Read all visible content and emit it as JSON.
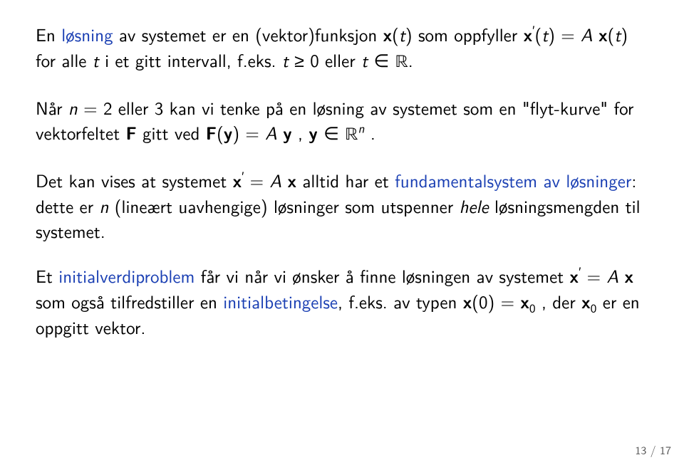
{
  "para1": {
    "t1": "En ",
    "t2": "løsning",
    "t3": " av systemet er en (vektor)funksjon ",
    "t4": "x",
    "t5": "(",
    "t6": "t",
    "t7": ") som oppfyller ",
    "t8": "x",
    "t9": "′",
    "t10": "(",
    "t11": "t",
    "t12": ") = ",
    "t13": "A",
    "t14": " ",
    "t15": "x",
    "t16": "(",
    "t17": "t",
    "t18": ") for alle ",
    "t19": "t",
    "t20": " i et gitt intervall, f.eks. ",
    "t21": "t",
    "t22": " ≥ 0 eller ",
    "t23": "t",
    "t24": " ∈ ",
    "t25": "ℝ",
    "t26": "."
  },
  "para2": {
    "t1": "Når ",
    "t2": "n",
    "t3": " = 2 eller 3 kan vi tenke på en løsning av systemet som en \"flyt-kurve\" for vektorfeltet ",
    "t4": "F",
    "t5": " gitt ved ",
    "t6": "F",
    "t7": "(",
    "t8": "y",
    "t9": ") = ",
    "t10": "A",
    "t11": " ",
    "t12": "y",
    "t13": " , ",
    "t14": "y",
    "t15": " ∈ ",
    "t16": "ℝ",
    "t17": "n",
    "t18": " ."
  },
  "para3": {
    "t1": "Det kan vises at systemet ",
    "t2": "x",
    "t3": "′",
    "t4": " = ",
    "t5": "A",
    "t6": " ",
    "t7": "x",
    "t8": " alltid har et ",
    "t9": "fundamentalsystem av løsninger",
    "t10": ": dette er ",
    "t11": "n",
    "t12": " (lineært uavhengige) løsninger som utspenner ",
    "t13": "hele",
    "t14": " løsningsmengden til systemet."
  },
  "para4": {
    "t1": "Et ",
    "t2": "initialverdiproblem",
    "t3": " får vi når vi ønsker å finne løsningen av systemet ",
    "t4": "x",
    "t5": "′",
    "t6": " = ",
    "t7": "A",
    "t8": " ",
    "t9": "x",
    "t10": " som også tilfredstiller en ",
    "t11": "initialbetingelse",
    "t12": ", f.eks. av typen ",
    "t13": "x",
    "t14": "(0) = ",
    "t15": "x",
    "t16": "0",
    "t17": " , der ",
    "t18": "x",
    "t19": "0",
    "t20": " er en oppgitt vektor."
  },
  "pagenum": "13 / 17"
}
